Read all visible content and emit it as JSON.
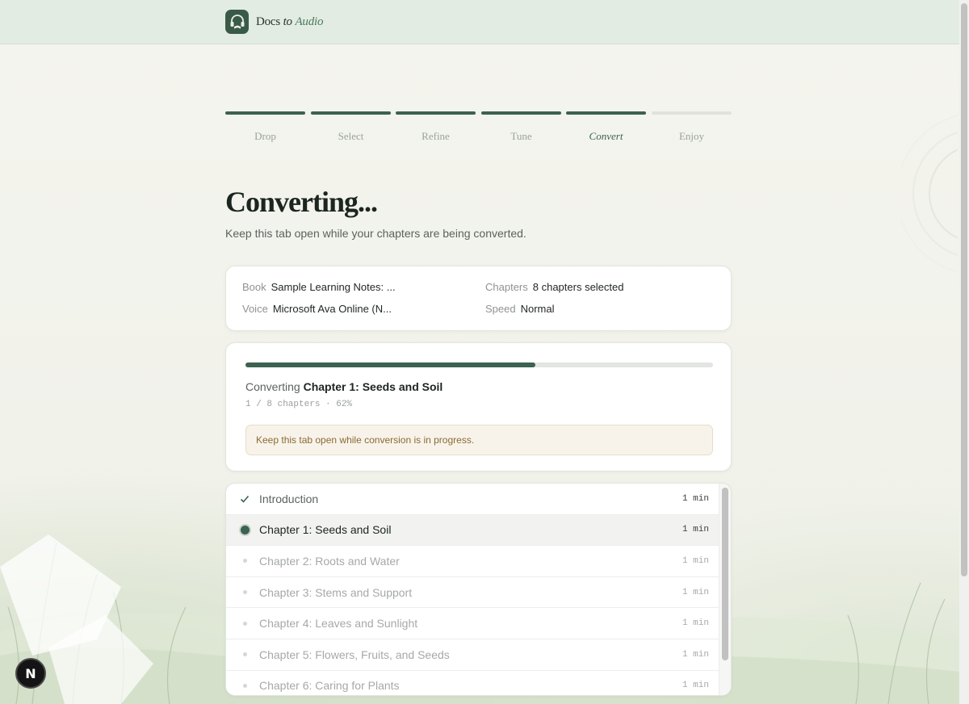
{
  "app": {
    "logo_text_docs": "Docs",
    "logo_text_to": "to",
    "logo_text_audio": "Audio"
  },
  "steps": [
    {
      "label": "Drop",
      "state": "done"
    },
    {
      "label": "Select",
      "state": "done"
    },
    {
      "label": "Refine",
      "state": "done"
    },
    {
      "label": "Tune",
      "state": "done"
    },
    {
      "label": "Convert",
      "state": "active"
    },
    {
      "label": "Enjoy",
      "state": "pending"
    }
  ],
  "page": {
    "title": "Converting...",
    "subtitle": "Keep this tab open while your chapters are being converted."
  },
  "summary": {
    "book_key": "Book",
    "book_value": "Sample Learning Notes: ...",
    "chapters_key": "Chapters",
    "chapters_value": "8 chapters selected",
    "voice_key": "Voice",
    "voice_value": "Microsoft Ava Online (N...",
    "speed_key": "Speed",
    "speed_value": "Normal"
  },
  "progress": {
    "percent": 62,
    "converting_prefix": "Converting",
    "current_chapter": "Chapter 1: Seeds and Soil",
    "count_text": "1 / 8 chapters · 62%",
    "notice": "Keep this tab open while conversion is in progress."
  },
  "chapters": [
    {
      "title": "Introduction",
      "duration": "1 min",
      "state": "done"
    },
    {
      "title": "Chapter 1: Seeds and Soil",
      "duration": "1 min",
      "state": "current"
    },
    {
      "title": "Chapter 2: Roots and Water",
      "duration": "1 min",
      "state": "pending"
    },
    {
      "title": "Chapter 3: Stems and Support",
      "duration": "1 min",
      "state": "pending"
    },
    {
      "title": "Chapter 4: Leaves and Sunlight",
      "duration": "1 min",
      "state": "pending"
    },
    {
      "title": "Chapter 5: Flowers, Fruits, and Seeds",
      "duration": "1 min",
      "state": "pending"
    },
    {
      "title": "Chapter 6: Caring for Plants",
      "duration": "1 min",
      "state": "pending"
    }
  ],
  "dev_badge": "N",
  "colors": {
    "accent": "#3c6250",
    "topbar": "#e3ece2",
    "notice_bg": "#f8f3ea",
    "notice_text": "#8a6a33"
  }
}
